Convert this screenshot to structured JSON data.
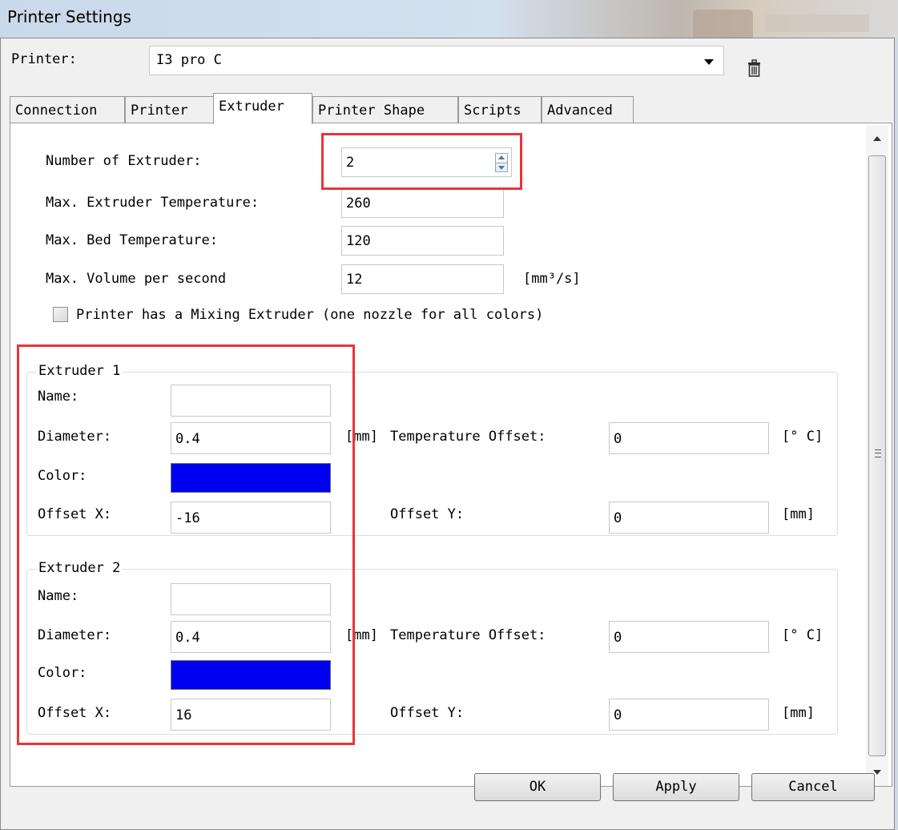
{
  "window": {
    "title": "Printer Settings"
  },
  "printer": {
    "label": "Printer:",
    "value": "I3 pro C"
  },
  "tabs": [
    {
      "label": "Connection"
    },
    {
      "label": "Printer"
    },
    {
      "label": "Extruder"
    },
    {
      "label": "Printer Shape"
    },
    {
      "label": "Scripts"
    },
    {
      "label": "Advanced"
    }
  ],
  "active_tab": "Extruder",
  "general": {
    "num_extruder_label": "Number of Extruder:",
    "num_extruder_value": "2",
    "max_extruder_temp_label": "Max. Extruder Temperature:",
    "max_extruder_temp_value": "260",
    "max_bed_temp_label": "Max. Bed Temperature:",
    "max_bed_temp_value": "120",
    "max_volume_label": "Max. Volume per second",
    "max_volume_value": "12",
    "max_volume_unit": "[mm³/s]",
    "mixing_label": "Printer has a Mixing Extruder (one nozzle for all colors)",
    "mixing_checked": false
  },
  "extruders": [
    {
      "title": "Extruder 1",
      "name_label": "Name:",
      "name_value": "",
      "diameter_label": "Diameter:",
      "diameter_value": "0.4",
      "diameter_unit": "[mm]",
      "temp_offset_label": "Temperature Offset:",
      "temp_offset_value": "0",
      "temp_unit": "[° C]",
      "color_label": "Color:",
      "color_value": "#0000f0",
      "offset_x_label": "Offset X:",
      "offset_x_value": "-16",
      "offset_y_label": "Offset Y:",
      "offset_y_value": "0",
      "offset_unit": "[mm]"
    },
    {
      "title": "Extruder 2",
      "name_label": "Name:",
      "name_value": "",
      "diameter_label": "Diameter:",
      "diameter_value": "0.4",
      "diameter_unit": "[mm]",
      "temp_offset_label": "Temperature Offset:",
      "temp_offset_value": "0",
      "temp_unit": "[° C]",
      "color_label": "Color:",
      "color_value": "#0000f0",
      "offset_x_label": "Offset X:",
      "offset_x_value": "16",
      "offset_y_label": "Offset Y:",
      "offset_y_value": "0",
      "offset_unit": "[mm]"
    }
  ],
  "buttons": {
    "ok": "OK",
    "apply": "Apply",
    "cancel": "Cancel"
  },
  "icons": {
    "delete": "trash-icon",
    "dropdown": "chevron-down-icon",
    "spinner": "spinner-arrows-icon"
  },
  "colors": {
    "highlight": "#e8343c",
    "extruder_color": "#0000f0"
  }
}
